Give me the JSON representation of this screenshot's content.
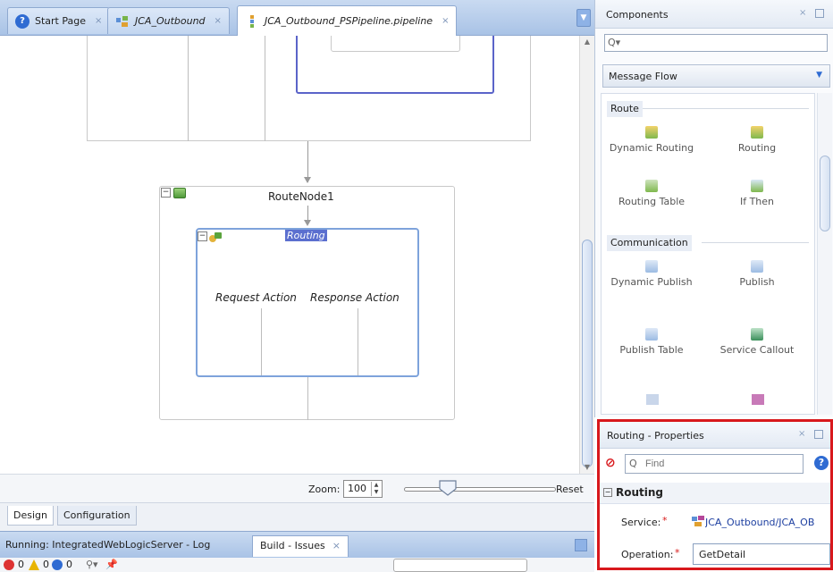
{
  "editor_tabs": [
    {
      "label": "Start Page",
      "icon": "help-icon",
      "close": "×"
    },
    {
      "label": "JCA_Outbound",
      "icon": "service-icon",
      "close": "×"
    },
    {
      "label": "JCA_Outbound_PSPipeline.pipeline",
      "icon": "pipeline-icon",
      "close": "×"
    }
  ],
  "canvas": {
    "route_node_label": "RouteNode1",
    "routing_label": "Routing",
    "request_action": "Request Action",
    "response_action": "Response Action",
    "expand_glyph": "−"
  },
  "zoom": {
    "label": "Zoom:",
    "value": "100",
    "reset": "Reset",
    "level_percent": 100
  },
  "design_tabs": [
    "Design",
    "Configuration"
  ],
  "log_tabs": [
    {
      "label": "Running: IntegratedWebLogicServer - Log"
    },
    {
      "label": "Build - Issues",
      "close": "×"
    }
  ],
  "log_counts": {
    "errors": "0",
    "warnings": "0",
    "infos": "0"
  },
  "components": {
    "title": "Components",
    "search_placeholder": "",
    "category": "Message Flow",
    "sections": [
      {
        "title": "Route",
        "items": [
          "Dynamic Routing",
          "Routing",
          "Routing Table",
          "If Then"
        ]
      },
      {
        "title": "Communication",
        "items": [
          "Dynamic Publish",
          "Publish",
          "Publish Table",
          "Service Callout"
        ]
      }
    ]
  },
  "properties": {
    "title": "Routing - Properties",
    "find_placeholder": "Find",
    "section": "Routing",
    "service_label": "Service:",
    "service_value": "JCA_Outbound/JCA_OB",
    "operation_label": "Operation:",
    "operation_value": "GetDetail"
  },
  "colors": {
    "highlight_border": "#d8181c",
    "routing_border": "#7ea3db",
    "stage_border": "#5b64c9"
  }
}
